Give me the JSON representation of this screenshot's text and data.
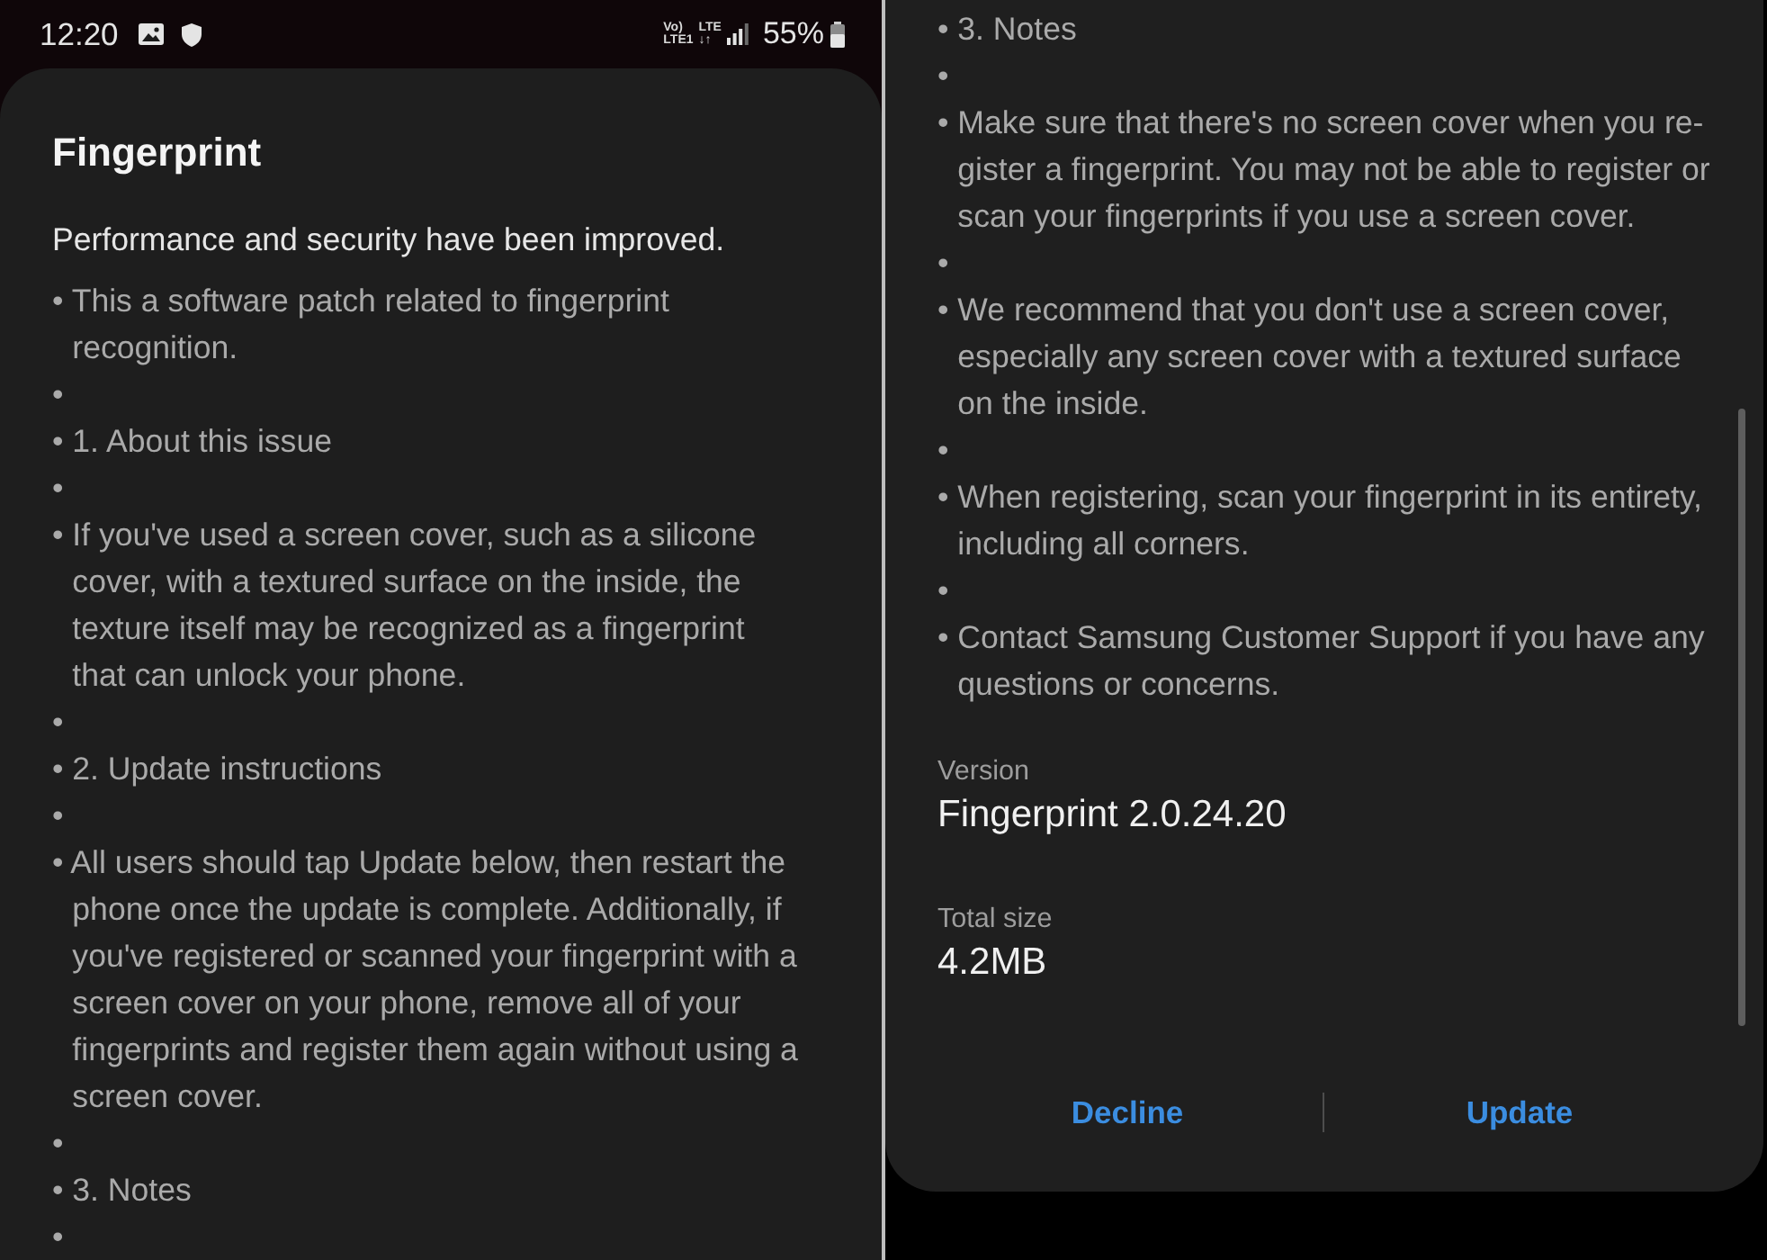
{
  "left_screen": {
    "status_bar": {
      "time": "12:20",
      "network": [
        {
          "top": "Vo)",
          "bottom": "LTE1"
        },
        {
          "top": "LTE",
          "bottom": "↓↑"
        }
      ],
      "battery": "55%"
    },
    "dialog": {
      "title": "Fingerprint",
      "summary": "Performance and security have been improved.",
      "notes": [
        "• This a software patch related to fingerprint recognition.",
        "•",
        "• 1. About this issue",
        "•",
        "• If you've used a screen cover, such as a silicone cover, with a textured surface on the inside, the texture itself may be recognized as a fingerprint that can unlock your phone.",
        "•",
        "• 2. Update instructions",
        "•",
        "• All users should tap Update below, then restart the phone once the update is complete. Additionally, if you've registered or scanned your fingerprint with a screen cover on your phone, remove all of your fingerprints and register them again without using a screen cover.",
        "•",
        "• 3. Notes",
        "•"
      ]
    }
  },
  "right_screen": {
    "dialog": {
      "notes": [
        "• 3. Notes",
        "•",
        "• Make sure that there's no screen cover when you re-gister a fingerprint. You may not be able to register or scan your fingerprints if you use a screen cover.",
        "•",
        "• We recommend that you don't use a screen cover, especially any screen cover with a textured surface on the inside.",
        "•",
        "• When registering, scan your fingerprint in its entirety, including all corners.",
        "•",
        "• Contact Samsung Customer Support if you have any questions or concerns."
      ],
      "version": {
        "label": "Version",
        "value": "Fingerprint 2.0.24.20"
      },
      "size": {
        "label": "Total size",
        "value": "4.2MB"
      },
      "buttons": [
        "Decline",
        "Update"
      ]
    }
  }
}
